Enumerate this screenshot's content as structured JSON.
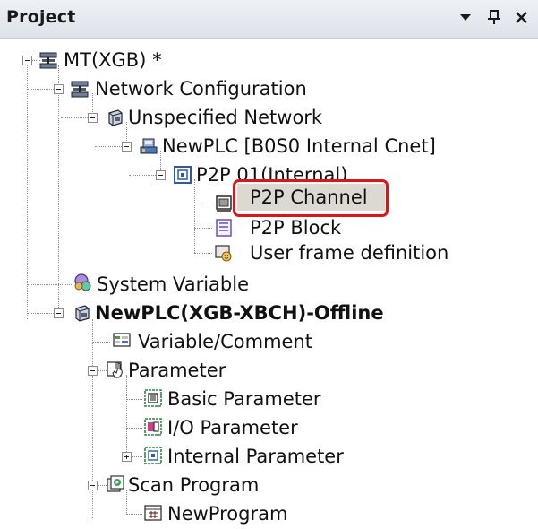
{
  "panel": {
    "title": "Project",
    "buttons": {
      "dropdown_glyph": "▾",
      "pin_glyph": "ᵖ",
      "close_glyph": "×"
    }
  },
  "tree": {
    "root": "MT(XGB) *",
    "network_configuration": "Network Configuration",
    "unspecified_network": "Unspecified Network",
    "newplc_cnet": "NewPLC [B0S0 Internal Cnet]",
    "p2p_01": "P2P 01(Internal)",
    "p2p_channel": "P2P Channel",
    "p2p_block": "P2P Block",
    "user_frame": "User frame definition",
    "system_variable": "System Variable",
    "newplc_offline": "NewPLC(XGB-XBCH)-Offline",
    "variable_comment": "Variable/Comment",
    "parameter": "Parameter",
    "basic_parameter": "Basic Parameter",
    "io_parameter": "I/O Parameter",
    "internal_parameter": "Internal Parameter",
    "scan_program": "Scan Program",
    "new_program": "NewProgram"
  },
  "colors": {
    "highlight": "#e01414",
    "selection": "#dcd9d2"
  }
}
